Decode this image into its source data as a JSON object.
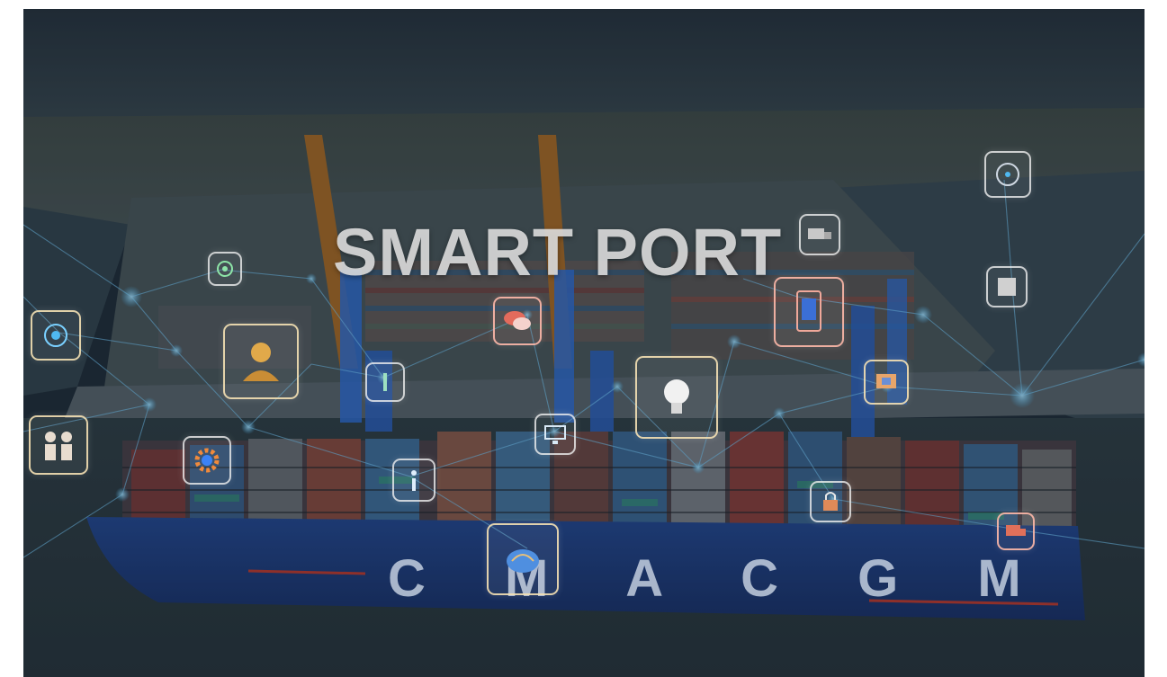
{
  "title": "SMART PORT",
  "hull_text": "C M A  C G M",
  "colors": {
    "sky": "#2a3743",
    "water": "#2d3b42",
    "network_line": "#7ad0ff",
    "network_node": "#4fb8f0",
    "hull": "#1e3f8a",
    "crane": "#2f6fd6"
  },
  "icons": [
    "target-icon",
    "person-icon",
    "people-icon",
    "gear-icon",
    "chat-icon",
    "lightbulb-icon",
    "tablet-icon",
    "monitor-icon",
    "lock-icon",
    "chip-icon",
    "compass-icon",
    "brain-icon",
    "info-icon",
    "truck-icon"
  ]
}
